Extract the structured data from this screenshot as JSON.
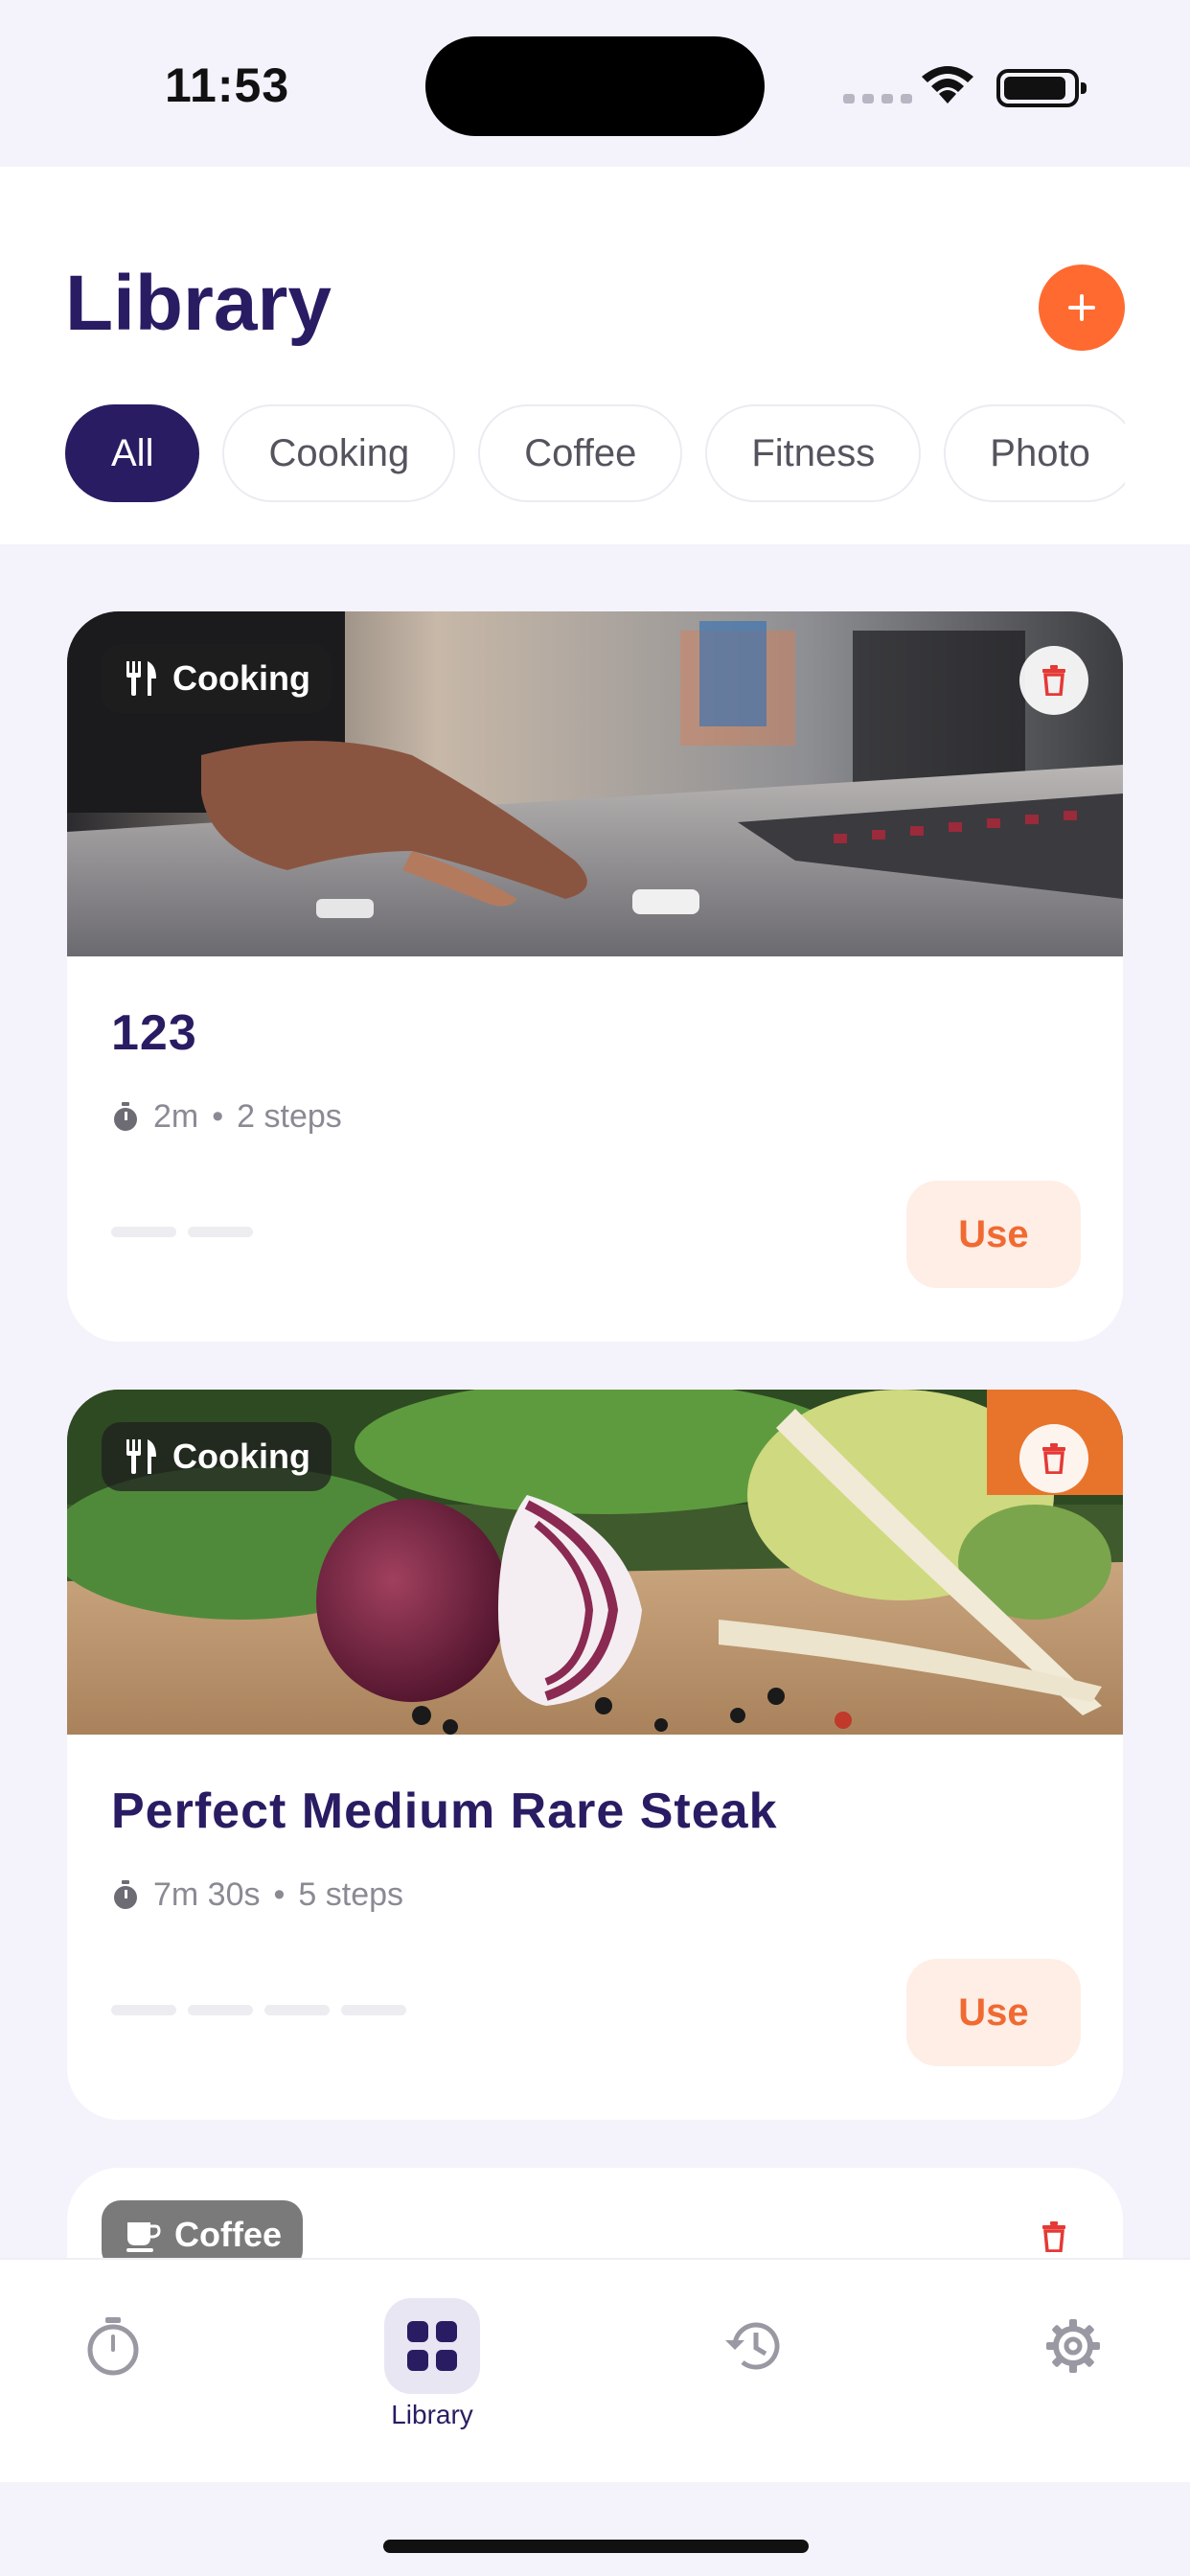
{
  "status_bar": {
    "time": "11:53"
  },
  "header": {
    "title": "Library",
    "add_button_label": "+",
    "filters": [
      "All",
      "Cooking",
      "Coffee",
      "Fitness",
      "Photo"
    ],
    "active_filter": "All"
  },
  "cards": [
    {
      "category": "Cooking",
      "category_icon": "fork-knife-icon",
      "title": "123",
      "duration": "2m",
      "steps": "2 steps",
      "step_count": 2,
      "action_label": "Use"
    },
    {
      "category": "Cooking",
      "category_icon": "fork-knife-icon",
      "title": "Perfect Medium Rare Steak",
      "duration": "7m 30s",
      "steps": "5 steps",
      "step_count": 4,
      "action_label": "Use"
    },
    {
      "category": "Coffee",
      "category_icon": "coffee-cup-icon"
    }
  ],
  "meta_separator": "•",
  "tab_bar": {
    "tabs": [
      {
        "icon": "timer-icon",
        "label": ""
      },
      {
        "icon": "grid-icon",
        "label": "Library",
        "active": true
      },
      {
        "icon": "history-icon",
        "label": ""
      },
      {
        "icon": "gear-icon",
        "label": ""
      }
    ]
  },
  "colors": {
    "primary": "#2a1c63",
    "accent": "#ff6a30",
    "background": "#f4f2fb",
    "delete": "#e53935"
  }
}
